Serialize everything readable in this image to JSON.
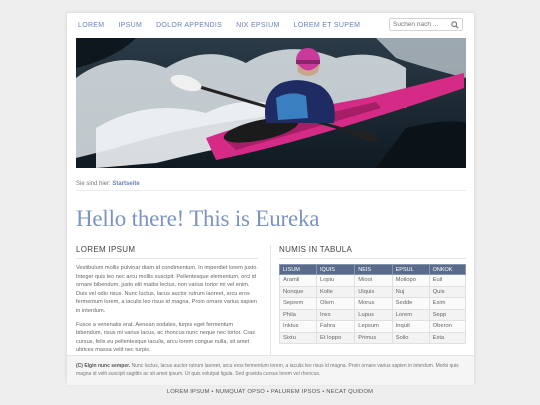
{
  "nav": {
    "items": [
      "LOREM",
      "IPSUM",
      "DOLOR APPENDIS",
      "NIX EPSIUM",
      "LOREM ET SUPEM"
    ],
    "search_placeholder": "Suchen nach ..."
  },
  "breadcrumb": {
    "prefix": "Sie sind hier:",
    "current": "Startseite"
  },
  "hero_title": "Hello there! This is Eureka",
  "left": {
    "title": "LOREM IPSUM",
    "paragraphs": [
      "Vestibulum mollis pulvinar diam id condimentum. In imperdiet lorem justo. Integer quis leo nec arcu mollis suscipit. Pellentesque elementum, orci id ornare bibendum, justo elit mattis lectus, non varius tortor mi vel enim. Duis vel odio risus. Nunc luctus, lacus auctor rutrum laoreet, arcu eros fermentum lorem, a iaculis leo risus id magna. Proin ornare varius sapien in interdum.",
      "Fusce a venenatis erat. Aenean sodales, turpis eget fermentum bibendum, risus mi varius lacus, ac rhoncus nunc neque nec tortor. Cras cursus, felis eu pellentesque iaculis, arcu lorem congue nulla, sit amet ultrices massa velit nec turpis."
    ]
  },
  "right": {
    "title": "NUMIS IN TABULA",
    "headers": [
      "LISUM",
      "IQUIS",
      "NEIS",
      "EPSUL",
      "ONKOK"
    ],
    "rows": [
      [
        "Aramli",
        "Lopiu",
        "Miooi",
        "Moilopo",
        "Euil"
      ],
      [
        "Nonque",
        "Kolle",
        "Ulquis",
        "Nuj",
        "Quis"
      ],
      [
        "Seprem",
        "Olem",
        "Morus",
        "Sedde",
        "Exim"
      ],
      [
        "Phila",
        "Inxs",
        "Lupus",
        "Lorem",
        "Sepp"
      ],
      [
        "Inktus",
        "Fahra",
        "Lepsum",
        "Inquit",
        "Oberon"
      ],
      [
        "Sixtu",
        "Et loppo",
        "Primus",
        "Solio",
        "Exta"
      ]
    ]
  },
  "footer": {
    "copyright": "(C) Elgin nunc semper.",
    "text1": "Nunc luctus, lacus auctor rutrum laoreet, arcu eros fermentum lorem, a iaculis leo risus id magna. Proin ornare varius sapien in interdum.",
    "text2": "Morbi quis magna id velit suscipit sagittis ac sit amet ipsum. Ut quis volutpat ligula. Sed gravida cursus lorem vel rhoncus."
  },
  "bottom_links": [
    "LOREM IPSUM",
    "NUMQUAT OPSO",
    "PALUREM IPSOS",
    "NECAT QUIDOM"
  ],
  "colors": {
    "accent": "#7c93c4",
    "nav": "#6a82b8",
    "table_header": "#5a6a8a"
  }
}
